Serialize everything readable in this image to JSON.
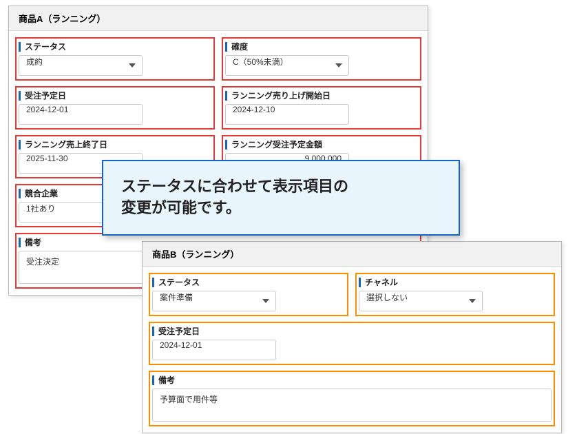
{
  "panelA": {
    "title": "商品A（ランニング）",
    "fields": {
      "status": {
        "label": "ステータス",
        "value": "成約"
      },
      "confidence": {
        "label": "確度",
        "value": "C（50%未満）"
      },
      "orderDate": {
        "label": "受注予定日",
        "value": "2024-12-01"
      },
      "runStart": {
        "label": "ランニング売り上げ開始日",
        "value": "2024-12-10"
      },
      "runEnd": {
        "label": "ランニング売上終了日",
        "value": "2025-11-30"
      },
      "amount": {
        "label": "ランニング受注予定金額",
        "value": "9,000,000"
      },
      "competitor": {
        "label": "競合企業",
        "value": "1社あり"
      },
      "note": {
        "label": "備考",
        "value": "受注決定"
      }
    }
  },
  "panelB": {
    "title": "商品B（ランニング）",
    "fields": {
      "status": {
        "label": "ステータス",
        "value": "案件準備"
      },
      "channel": {
        "label": "チャネル",
        "value": "選択しない"
      },
      "orderDate": {
        "label": "受注予定日",
        "value": "2024-12-01"
      },
      "note": {
        "label": "備考",
        "value": "予算面で用件等"
      }
    }
  },
  "callout": {
    "line1": "ステータスに合わせて表示項目の",
    "line2": "変更が可能です。"
  }
}
